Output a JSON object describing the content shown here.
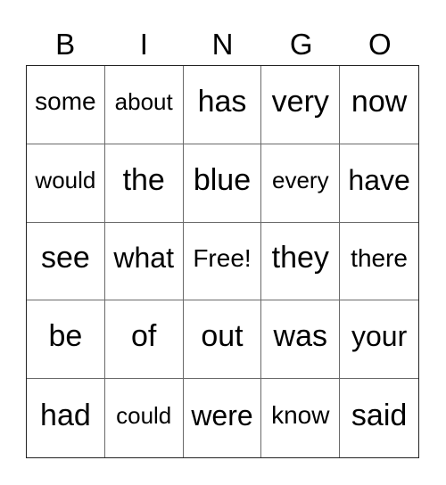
{
  "header": {
    "letters": [
      "B",
      "I",
      "N",
      "G",
      "O"
    ]
  },
  "card": {
    "rows": [
      [
        "some",
        "about",
        "has",
        "very",
        "now"
      ],
      [
        "would",
        "the",
        "blue",
        "every",
        "have"
      ],
      [
        "see",
        "what",
        "Free!",
        "they",
        "there"
      ],
      [
        "be",
        "of",
        "out",
        "was",
        "your"
      ],
      [
        "had",
        "could",
        "were",
        "know",
        "said"
      ]
    ]
  }
}
